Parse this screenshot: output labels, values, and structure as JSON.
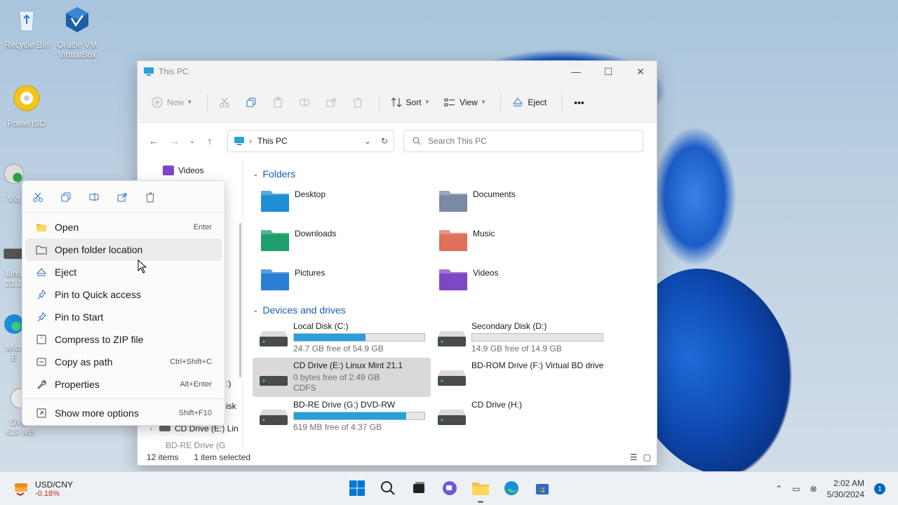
{
  "desktop": {
    "icons": [
      {
        "label": "Recycle Bin"
      },
      {
        "label": "Oracle VM\nVirtualBox"
      },
      {
        "label": "PowerISO"
      },
      {
        "label": "Virt"
      },
      {
        "label": "Linu\n21.1"
      },
      {
        "label": "Micr\nE"
      },
      {
        "label": "DVD-\n619 MB"
      }
    ]
  },
  "window": {
    "title": "This PC",
    "controls": {
      "minimize": "—",
      "maximize": "☐",
      "close": "✕"
    },
    "commandbar": {
      "new_label": "New",
      "sort_label": "Sort",
      "view_label": "View",
      "eject_label": "Eject",
      "more_label": "•••"
    },
    "address": {
      "location": "This PC"
    },
    "search": {
      "placeholder": "Search This PC"
    },
    "navpane": {
      "videos": "Videos",
      "partial1": ":)",
      "partial2": "isk",
      "cd_drive": "CD Drive (E:) Lin",
      "bdre_partial": "BD-RE Drive (G"
    },
    "sections": {
      "folders": "Folders",
      "devices": "Devices and drives"
    },
    "folders": [
      {
        "name": "Desktop",
        "color": "#1e8fd6"
      },
      {
        "name": "Documents",
        "color": "#7b8aa3"
      },
      {
        "name": "Downloads",
        "color": "#1f9e6e"
      },
      {
        "name": "Music",
        "color": "#e0705a"
      },
      {
        "name": "Pictures",
        "color": "#2a7fd4"
      },
      {
        "name": "Videos",
        "color": "#7d47c6"
      }
    ],
    "drives": [
      {
        "name": "Local Disk (C:)",
        "free": "24.7 GB free of 54.9 GB",
        "fill_pct": 55,
        "selected": false
      },
      {
        "name": "Secondary Disk (D:)",
        "free": "14.9 GB free of 14.9 GB",
        "fill_pct": 0,
        "selected": false
      },
      {
        "name": "CD Drive (E:) Linux Mint 21.1",
        "free": "0 bytes free of 2.49 GB",
        "fs": "CDFS",
        "selected": true
      },
      {
        "name": "BD-ROM Drive (F:) Virtual BD drive",
        "selected": false
      },
      {
        "name": "BD-RE Drive (G:) DVD-RW",
        "free": "619 MB free of 4.37 GB",
        "fill_pct": 86,
        "selected": false
      },
      {
        "name": "CD Drive (H:)",
        "selected": false
      }
    ],
    "status": {
      "items": "12 items",
      "selected": "1 item selected"
    }
  },
  "context_menu": {
    "items": [
      {
        "label": "Open",
        "shortcut": "Enter"
      },
      {
        "label": "Open folder location",
        "shortcut": ""
      },
      {
        "label": "Eject",
        "shortcut": ""
      },
      {
        "label": "Pin to Quick access",
        "shortcut": ""
      },
      {
        "label": "Pin to Start",
        "shortcut": ""
      },
      {
        "label": "Compress to ZIP file",
        "shortcut": ""
      },
      {
        "label": "Copy as path",
        "shortcut": "Ctrl+Shift+C"
      },
      {
        "label": "Properties",
        "shortcut": "Alt+Enter"
      },
      {
        "label": "Show more options",
        "shortcut": "Shift+F10"
      }
    ]
  },
  "taskbar": {
    "ticker_name": "USD/CNY",
    "ticker_change": "-0.18%",
    "time": "2:02 AM",
    "date": "5/30/2024",
    "notification_count": "1"
  },
  "colors": {
    "accent": "#0067c0",
    "progress": "#26a0da",
    "selection": "#d9d9d9"
  }
}
